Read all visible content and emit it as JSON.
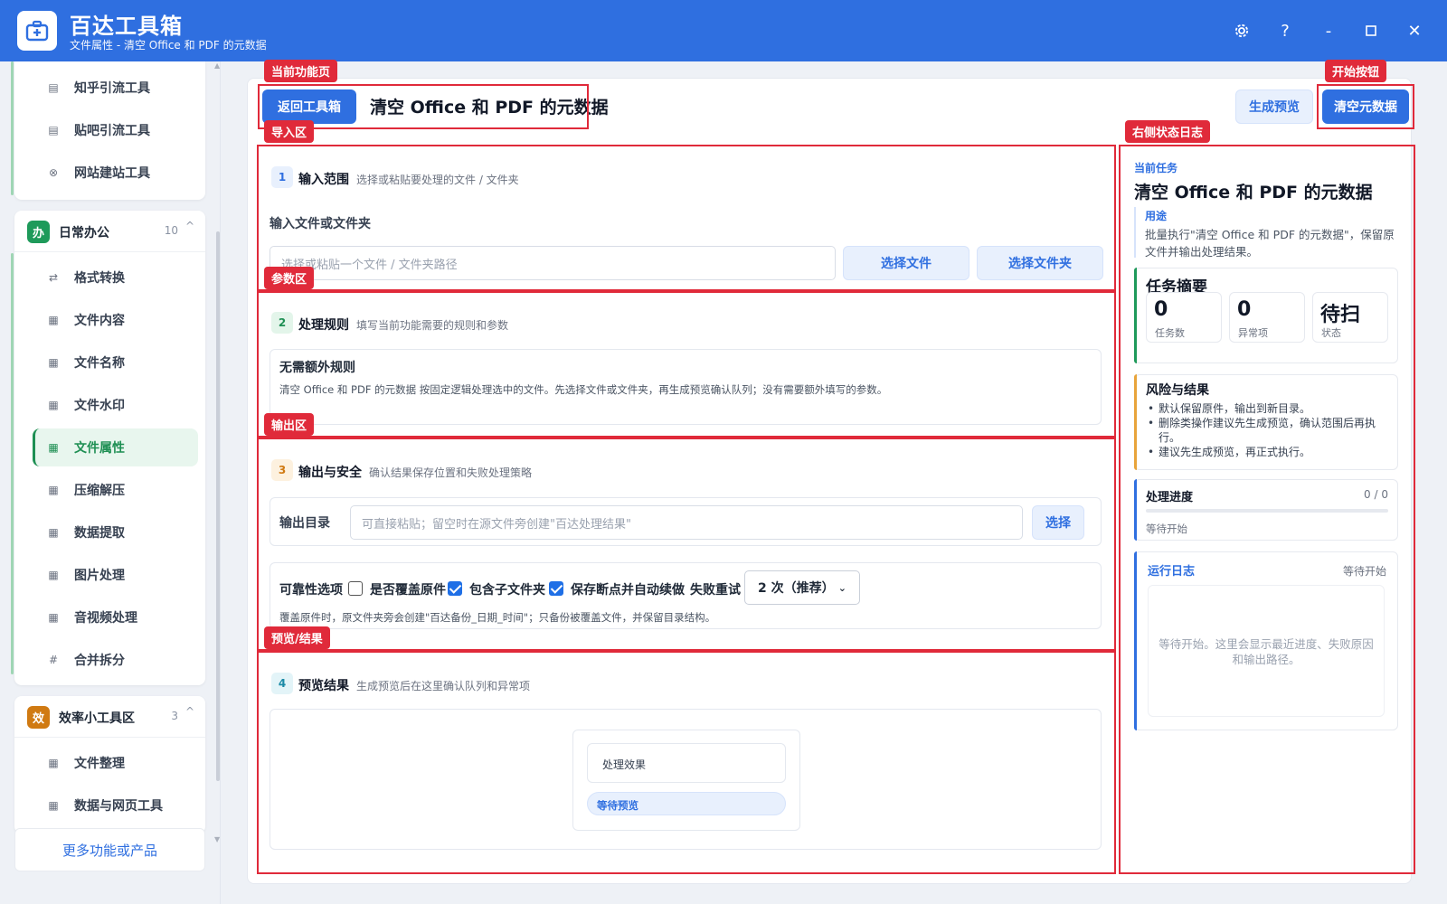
{
  "app": {
    "title": "百达工具箱",
    "subtitle": "文件属性 - 清空 Office 和 PDF 的元数据"
  },
  "window_controls": {
    "settings_icon": "gear-icon",
    "help": "?",
    "minimize": "-",
    "maximize": "□",
    "close": "✕"
  },
  "sidebar": {
    "group_top_items": [
      {
        "label": "知乎引流工具",
        "icon": "list-icon"
      },
      {
        "label": "贴吧引流工具",
        "icon": "list-icon"
      },
      {
        "label": "网站建站工具",
        "icon": "globe-icon"
      }
    ],
    "group_office": {
      "badge": "办",
      "badge_color": "#1e9a5a",
      "label": "日常办公",
      "count": "10",
      "caret": "^",
      "items": [
        {
          "label": "格式转换",
          "icon": "⇄"
        },
        {
          "label": "文件内容",
          "icon": "▦"
        },
        {
          "label": "文件名称",
          "icon": "▦"
        },
        {
          "label": "文件水印",
          "icon": "▦"
        },
        {
          "label": "文件属性",
          "icon": "▦",
          "active": true
        },
        {
          "label": "压缩解压",
          "icon": "▦"
        },
        {
          "label": "数据提取",
          "icon": "▦"
        },
        {
          "label": "图片处理",
          "icon": "▦"
        },
        {
          "label": "音视频处理",
          "icon": "▦"
        },
        {
          "label": "合并拆分",
          "icon": "#"
        }
      ]
    },
    "group_efficiency": {
      "badge": "效",
      "badge_color": "#d07a12",
      "label": "效率小工具区",
      "count": "3",
      "caret": "^",
      "items": [
        {
          "label": "文件整理",
          "icon": "▦"
        },
        {
          "label": "数据与网页工具",
          "icon": "▦"
        }
      ]
    },
    "more_link": "更多功能或产品"
  },
  "annotations": {
    "current_page": "当前功能页",
    "start_button": "开始按钮",
    "import_area": "导入区",
    "right_log": "右侧状态日志",
    "params_area": "参数区",
    "output_area": "输出区",
    "preview_area": "预览/结果",
    "color": "#e02a3a"
  },
  "header": {
    "back_button": "返回工具箱",
    "page_title": "清空 Office 和 PDF 的元数据",
    "preview_button": "生成预览",
    "start_button": "清空元数据"
  },
  "step1": {
    "num": "1",
    "title": "输入范围",
    "desc": "选择或粘贴要处理的文件 / 文件夹",
    "field_label": "输入文件或文件夹",
    "input_placeholder": "选择或粘贴一个文件 / 文件夹路径",
    "select_file": "选择文件",
    "select_folder": "选择文件夹"
  },
  "step2": {
    "num": "2",
    "title": "处理规则",
    "desc": "填写当前功能需要的规则和参数",
    "rule_title": "无需额外规则",
    "rule_desc": "清空 Office 和 PDF 的元数据 按固定逻辑处理选中的文件。先选择文件或文件夹，再生成预览确认队列；没有需要额外填写的参数。"
  },
  "step3": {
    "num": "3",
    "title": "输出与安全",
    "desc": "确认结果保存位置和失败处理策略",
    "output_label": "输出目录",
    "output_placeholder": "可直接粘贴；留空时在源文件旁创建\"百达处理结果\"",
    "select_button": "选择",
    "options_label": "可靠性选项",
    "opt_overwrite": "是否覆盖原件",
    "opt_overwrite_checked": false,
    "opt_subfolders": "包含子文件夹",
    "opt_subfolders_checked": true,
    "opt_resume": "保存断点并自动续做",
    "opt_resume_checked": true,
    "retry_label": "失败重试",
    "retry_value": "2 次（推荐）",
    "note": "覆盖原件时，原文件夹旁会创建\"百达备份_日期_时间\"；只备份被覆盖文件，并保留目录结构。"
  },
  "step4": {
    "num": "4",
    "title": "预览结果",
    "desc": "生成预览后在这里确认队列和异常项",
    "effect_label": "处理效果",
    "status_pill": "等待预览"
  },
  "right_panel": {
    "current_task_label": "当前任务",
    "task_title": "清空 Office 和 PDF 的元数据",
    "purpose_label": "用途",
    "purpose_text": "批量执行\"清空 Office 和 PDF 的元数据\"，保留原文件并输出处理结果。",
    "summary": {
      "title": "任务摘要",
      "stats": [
        {
          "value": "0",
          "label": "任务数"
        },
        {
          "value": "0",
          "label": "异常项"
        },
        {
          "value": "待扫",
          "label": "状态"
        }
      ]
    },
    "risk": {
      "title": "风险与结果",
      "items": [
        "默认保留原件，输出到新目录。",
        "删除类操作建议先生成预览，确认范围后再执行。",
        "建议先生成预览，再正式执行。"
      ]
    },
    "progress": {
      "title": "处理进度",
      "count": "0 / 0",
      "value": 0,
      "status": "等待开始"
    },
    "log": {
      "title": "运行日志",
      "status": "等待开始",
      "placeholder": "等待开始。这里会显示最近进度、失败原因和输出路径。"
    }
  },
  "colors": {
    "brand": "#2f6fe0",
    "active_green": "#1e8f53",
    "summary_accent": "#1e9a5a",
    "risk_accent": "#e8a43a",
    "log_accent": "#2f6fe0"
  }
}
